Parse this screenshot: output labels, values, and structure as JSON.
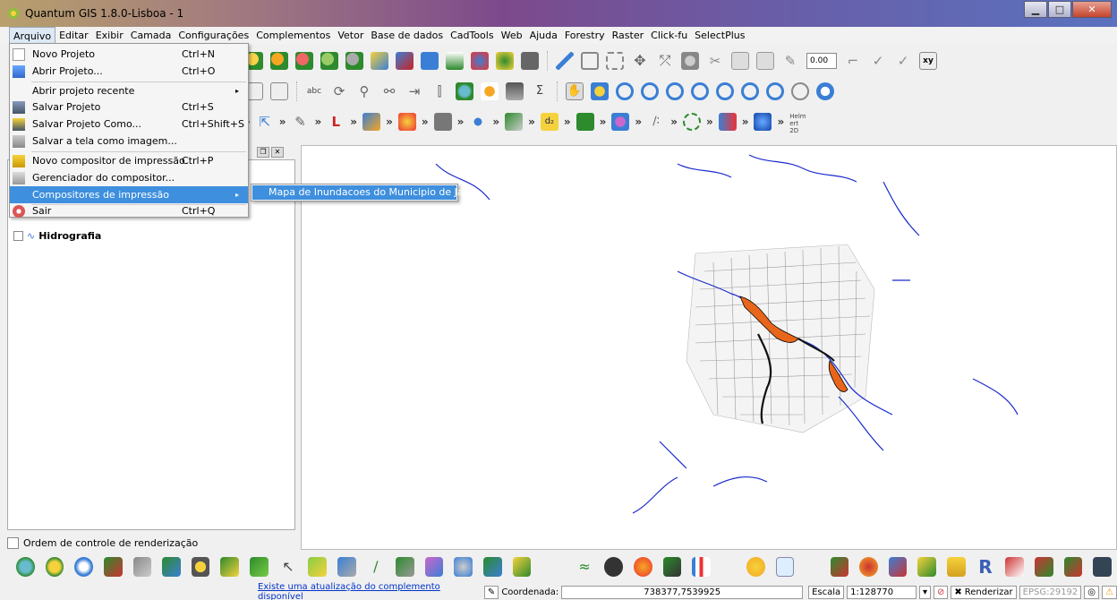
{
  "window": {
    "title": "Quantum GIS 1.8.0-Lisboa - 1"
  },
  "menubar": {
    "items": [
      "Arquivo",
      "Editar",
      "Exibir",
      "Camada",
      "Configurações",
      "Complementos",
      "Vetor",
      "Base de dados",
      "CadTools",
      "Web",
      "Ajuda",
      "Forestry",
      "Raster",
      "Click-fu",
      "SelectPlus"
    ]
  },
  "file_menu": {
    "items": [
      {
        "label": "Novo Projeto",
        "shortcut": "Ctrl+N",
        "icon": "new-project-icon"
      },
      {
        "label": "Abrir Projeto...",
        "shortcut": "Ctrl+O",
        "icon": "open-project-icon"
      },
      {
        "label": "Abrir projeto recente",
        "shortcut": "",
        "icon": ""
      },
      {
        "label": "Salvar Projeto",
        "shortcut": "Ctrl+S",
        "icon": "save-icon"
      },
      {
        "label": "Salvar Projeto Como...",
        "shortcut": "Ctrl+Shift+S",
        "icon": "save-as-icon"
      },
      {
        "label": "Salvar a tela como imagem...",
        "shortcut": "",
        "icon": "save-image-icon"
      },
      {
        "label": "Novo compositor de impressão",
        "shortcut": "Ctrl+P",
        "icon": "new-composer-icon"
      },
      {
        "label": "Gerenciador do compositor...",
        "shortcut": "",
        "icon": "composer-manager-icon"
      },
      {
        "label": "Compositores de impressão",
        "shortcut": "",
        "icon": ""
      },
      {
        "label": "Sair",
        "shortcut": "Ctrl+Q",
        "icon": "exit-icon"
      }
    ],
    "submenu_item": "Mapa de Inundacoes do Municipio de Jahu"
  },
  "toolbar": {
    "scale_input": "0.00",
    "xy_label": "xy",
    "helmert_label": "Helm ert 2D"
  },
  "layers": {
    "visible_layer": "Hidrografia"
  },
  "render_order": {
    "label": "Ordem de controle de renderização"
  },
  "statusbar": {
    "update_link": "Existe uma atualização do complemento disponível",
    "coord_label": "Coordenada:",
    "coord_value": "738377,7539925",
    "scale_label": "Escala",
    "scale_value": "1:128770",
    "render_label": "Renderizar",
    "epsg": "EPSG:29192"
  },
  "colors": {
    "highlight": "#3e8fde",
    "river": "#1a2bcc",
    "flood": "#e8661c"
  }
}
